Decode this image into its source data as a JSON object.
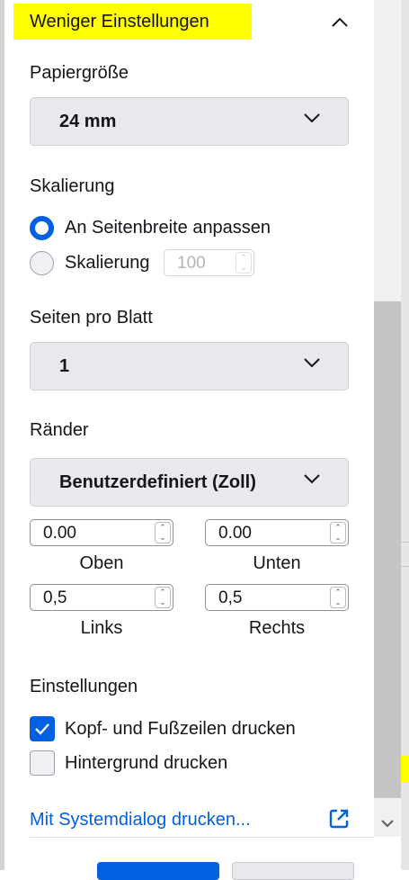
{
  "header": {
    "title": "Weniger Einstellungen",
    "highlight_color": "#ffff00"
  },
  "paper": {
    "label": "Papiergröße",
    "value": "24 mm"
  },
  "scaling": {
    "label": "Skalierung",
    "fit_option": "An Seitenbreite anpassen",
    "fit_selected": true,
    "scale_option": "Skalierung",
    "scale_value": "100"
  },
  "pages_per_sheet": {
    "label": "Seiten pro Blatt",
    "value": "1"
  },
  "margins": {
    "label": "Ränder",
    "value": "Benutzerdefiniert (Zoll)",
    "top_value": "0.00",
    "top_label": "Oben",
    "bottom_value": "0.00",
    "bottom_label": "Unten",
    "left_value": "0,5",
    "left_label": "Links",
    "right_value": "0,5",
    "right_label": "Rechts"
  },
  "settings": {
    "label": "Einstellungen",
    "headers_footers": "Kopf- und Fußzeilen drucken",
    "headers_footers_checked": true,
    "background": "Hintergrund drucken",
    "background_checked": false
  },
  "system_dialog": {
    "label": "Mit Systemdialog drucken..."
  },
  "colors": {
    "accent": "#0061e0",
    "control_bg": "#e9e9ed"
  }
}
